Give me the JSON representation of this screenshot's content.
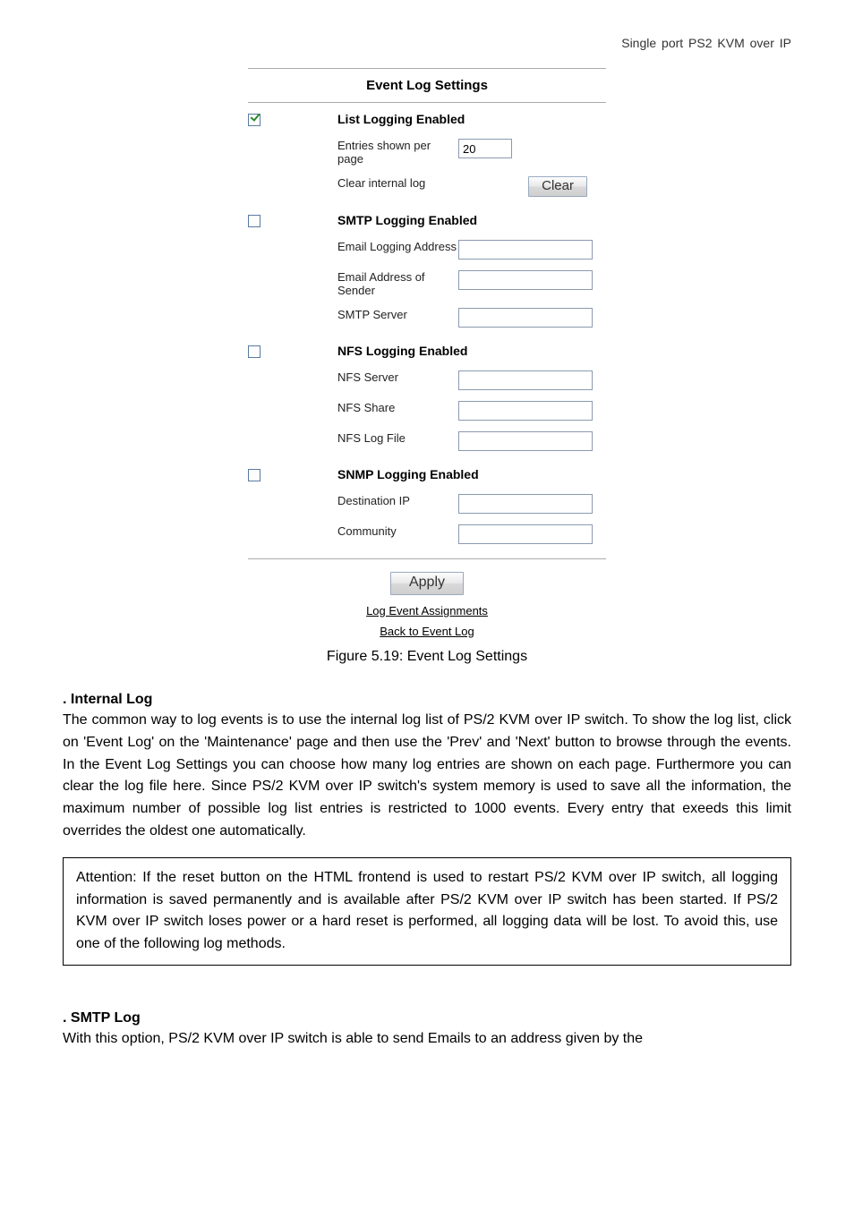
{
  "header": "Single port PS2 KVM over IP",
  "panel": {
    "title": "Event Log Settings",
    "sections": {
      "list": {
        "checked": true,
        "head": "List Logging Enabled",
        "entries_label": "Entries shown per page",
        "entries_value": "20",
        "clear_label": "Clear internal log",
        "clear_button": "Clear"
      },
      "smtp": {
        "checked": false,
        "head": "SMTP Logging Enabled",
        "email_addr_label": "Email Logging Address",
        "email_addr_value": "",
        "sender_label": "Email Address of Sender",
        "sender_value": "",
        "server_label": "SMTP Server",
        "server_value": ""
      },
      "nfs": {
        "checked": false,
        "head": "NFS Logging Enabled",
        "server_label": "NFS Server",
        "server_value": "",
        "share_label": "NFS Share",
        "share_value": "",
        "logfile_label": "NFS Log File",
        "logfile_value": ""
      },
      "snmp": {
        "checked": false,
        "head": "SNMP Logging Enabled",
        "dest_label": "Destination IP",
        "dest_value": "",
        "community_label": "Community",
        "community_value": ""
      }
    },
    "apply_button": "Apply",
    "link1": "Log Event Assignments",
    "link2": "Back to Event Log"
  },
  "figure_caption": "Figure 5.19: Event Log Settings",
  "doc": {
    "internal_head": ". Internal Log",
    "internal_body": "The common way to log events is to use the internal log list of PS/2 KVM over IP switch. To show the log list, click on 'Event Log' on the 'Maintenance' page and then use the 'Prev' and 'Next' button to browse through the events. In the Event Log Settings you can choose how many log entries are shown on each page. Furthermore you can clear the log file here. Since PS/2 KVM over IP switch's system memory is used to save all the information, the maximum number of possible log list entries is restricted to 1000 events. Every entry that exeeds this limit overrides the oldest one automatically.",
    "attention": "Attention: If the reset button on the HTML frontend is used to restart PS/2 KVM over IP switch, all logging information is saved permanently and is available after PS/2 KVM over IP switch has been started. If PS/2 KVM over IP switch loses power or a hard reset is performed, all logging data will be lost. To avoid this, use one of the following log methods.",
    "smtp_head": ". SMTP Log",
    "smtp_body": "With this option, PS/2 KVM over IP switch is able to send Emails to an address given by the"
  }
}
